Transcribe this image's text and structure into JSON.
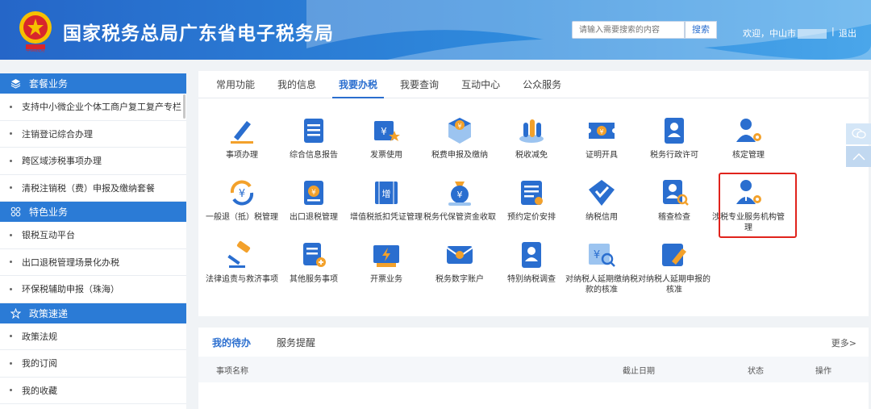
{
  "header": {
    "title": "国家税务总局广东省电子税务局",
    "search_placeholder": "请输入需要搜索的内容",
    "search_button": "搜索",
    "welcome": "欢迎，中山市",
    "separator": "|",
    "logout": "退出"
  },
  "sidebar": {
    "sections": [
      {
        "title": "套餐业务",
        "icon": "layers-icon",
        "items": [
          "支持中小微企业个体工商户复工复产专栏",
          "注销登记综合办理",
          "跨区域涉税事项办理",
          "清税注销税（费）申报及缴纳套餐"
        ]
      },
      {
        "title": "特色业务",
        "icon": "grid-icon",
        "items": [
          "银税互动平台",
          "出口退税管理场景化办税",
          "环保税辅助申报（珠海）"
        ]
      },
      {
        "title": "政策速递",
        "icon": "star-icon",
        "items": [
          "政策法规",
          "我的订阅",
          "我的收藏"
        ]
      }
    ]
  },
  "main": {
    "tabs": [
      "常用功能",
      "我的信息",
      "我要办税",
      "我要查询",
      "互动中心",
      "公众服务"
    ],
    "active_tab": "我要办税",
    "services": [
      {
        "label": "事项办理",
        "icon": "pen-icon"
      },
      {
        "label": "综合信息报告",
        "icon": "report-icon"
      },
      {
        "label": "发票使用",
        "icon": "invoice-star-icon"
      },
      {
        "label": "税费申报及缴纳",
        "icon": "tax-cube-icon"
      },
      {
        "label": "税收减免",
        "icon": "coins-icon"
      },
      {
        "label": "证明开具",
        "icon": "ticket-icon"
      },
      {
        "label": "税务行政许可",
        "icon": "id-card-icon"
      },
      {
        "label": "核定管理",
        "icon": "user-gear-icon"
      },
      {
        "label": "一般退（抵）税管理",
        "icon": "refund-icon"
      },
      {
        "label": "出口退税管理",
        "icon": "export-tax-icon"
      },
      {
        "label": "增值税抵扣凭证管理",
        "icon": "vat-icon"
      },
      {
        "label": "税务代保管资金收取",
        "icon": "money-bag-icon"
      },
      {
        "label": "预约定价安排",
        "icon": "list-check-icon"
      },
      {
        "label": "纳税信用",
        "icon": "shield-check-icon"
      },
      {
        "label": "稽查检查",
        "icon": "user-search-icon"
      },
      {
        "label": "涉税专业服务机构管理",
        "icon": "agent-gear-icon"
      },
      {
        "label": "法律追责与救济事项",
        "icon": "gavel-icon"
      },
      {
        "label": "其他服务事项",
        "icon": "doc-plus-icon"
      },
      {
        "label": "开票业务",
        "icon": "lightning-icon"
      },
      {
        "label": "税务数字账户",
        "icon": "mail-account-icon"
      },
      {
        "label": "特别纳税调查",
        "icon": "person-card-icon"
      },
      {
        "label": "对纳税人延期缴纳税款的核准",
        "icon": "tax-search-icon"
      },
      {
        "label": "对纳税人延期申报的核准",
        "icon": "edit-doc-icon"
      }
    ]
  },
  "todo": {
    "tabs": [
      "我的待办",
      "服务提醒"
    ],
    "active_tab": "我的待办",
    "more": "更多>",
    "columns": [
      "事项名称",
      "截止日期",
      "状态",
      "操作"
    ]
  },
  "colors": {
    "primary": "#2a6ecf",
    "highlight": "#e0231c",
    "sidebar_head": "#2b7bd6"
  }
}
